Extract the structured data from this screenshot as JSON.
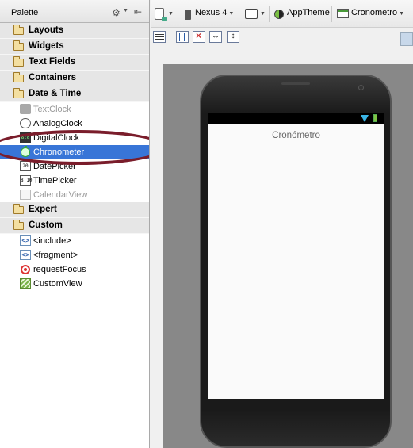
{
  "palette": {
    "title": "Palette",
    "categories": {
      "layouts": "Layouts",
      "widgets": "Widgets",
      "text_fields": "Text Fields",
      "containers": "Containers",
      "date_time": "Date & Time",
      "expert": "Expert",
      "custom": "Custom"
    },
    "date_time_items": {
      "textclock": "TextClock",
      "analogclock": "AnalogClock",
      "digitalclock": "DigitalClock",
      "chronometer": "Chronometer",
      "datepicker": "DatePicker",
      "timepicker": "TimePicker",
      "calendarview": "CalendarView"
    },
    "custom_items": {
      "include": "<include>",
      "fragment": "<fragment>",
      "requestfocus": "requestFocus",
      "customview": "CustomView"
    },
    "icon_text": {
      "digital": "8:8",
      "date": "20",
      "time": "8:10",
      "tag": "<>"
    },
    "selected_item": "Chronometer"
  },
  "toolbar": {
    "device": "Nexus 4",
    "theme": "AppTheme",
    "activity": "Cronometro",
    "hfill_glyph": "↔",
    "vfill_glyph": "↕"
  },
  "preview": {
    "app_title": "Cronómetro"
  },
  "colors": {
    "selection": "#3875d7",
    "highlight_ellipse": "#7a1d2b",
    "canvas": "#888888",
    "category_bg": "#e6e6e6"
  }
}
